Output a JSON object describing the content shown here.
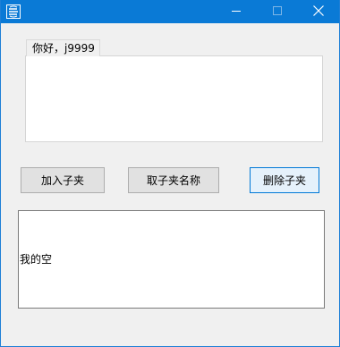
{
  "titlebar": {
    "icon": "app-icon",
    "minimize_icon": "minimize-icon",
    "maximize_icon": "maximize-icon",
    "close_icon": "close-icon"
  },
  "group": {
    "label": "你好，j9999"
  },
  "buttons": {
    "add_label": "加入子夹",
    "get_label": "取子夹名称",
    "delete_label": "删除子夹"
  },
  "textbox": {
    "value": "我的空"
  },
  "colors": {
    "titlebar": "#0a7ad6",
    "window_background": "#f0f0f0",
    "focused_button_border": "#0078d7"
  }
}
